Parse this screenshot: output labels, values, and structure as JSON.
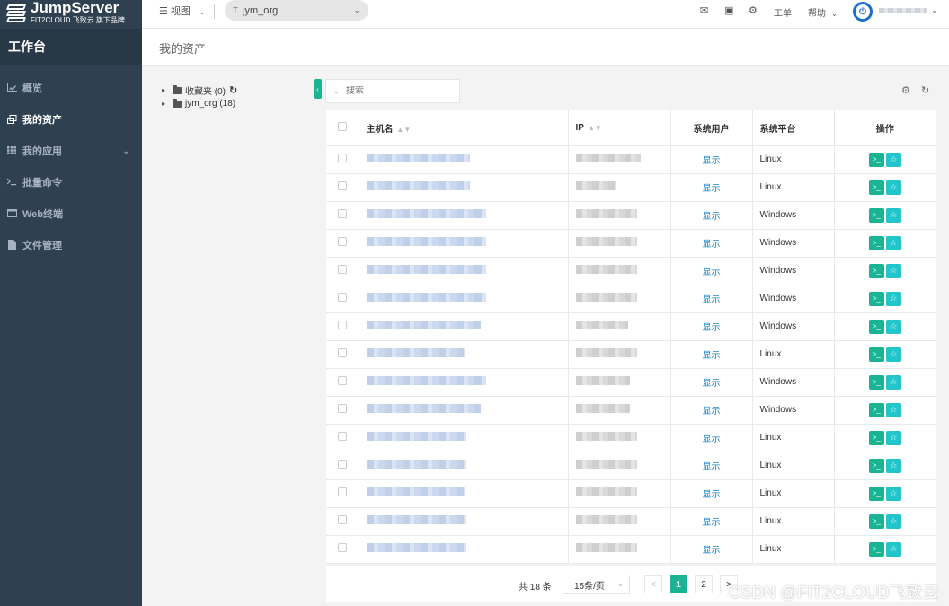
{
  "app": {
    "logo_title": "JumpServer",
    "logo_subtitle": "FIT2CLOUD 飞致云 旗下品牌",
    "workspace": "工作台"
  },
  "sidebar": {
    "items": [
      {
        "label": "概览",
        "icon": "chart-icon",
        "active": false
      },
      {
        "label": "我的资产",
        "icon": "assets-icon",
        "active": true
      },
      {
        "label": "我的应用",
        "icon": "apps-grid-icon",
        "active": false,
        "has_caret": true
      },
      {
        "label": "批量命令",
        "icon": "terminal-prompt-icon",
        "active": false
      },
      {
        "label": "Web终端",
        "icon": "window-icon",
        "active": false
      },
      {
        "label": "文件管理",
        "icon": "file-icon",
        "active": false
      }
    ]
  },
  "topnav": {
    "view_label": "视图",
    "org": "jym_org",
    "ticket_label": "工单",
    "help_label": "帮助"
  },
  "page": {
    "title": "我的资产"
  },
  "tree": {
    "nodes": [
      {
        "label": "收藏夹 (0)"
      },
      {
        "label": "jym_org (18)"
      }
    ]
  },
  "search": {
    "placeholder": "搜索"
  },
  "table": {
    "headers": {
      "hostname": "主机名",
      "ip": "IP",
      "system_user": "系统用户",
      "platform": "系统平台",
      "actions": "操作"
    },
    "show_label": "显示",
    "rows": [
      {
        "platform": "Linux",
        "host_w": 115,
        "ip_w": 72
      },
      {
        "platform": "Linux",
        "host_w": 115,
        "ip_w": 44
      },
      {
        "platform": "Windows",
        "host_w": 133,
        "ip_w": 68
      },
      {
        "platform": "Windows",
        "host_w": 133,
        "ip_w": 68
      },
      {
        "platform": "Windows",
        "host_w": 133,
        "ip_w": 68
      },
      {
        "platform": "Windows",
        "host_w": 133,
        "ip_w": 68
      },
      {
        "platform": "Windows",
        "host_w": 127,
        "ip_w": 58
      },
      {
        "platform": "Linux",
        "host_w": 109,
        "ip_w": 68
      },
      {
        "platform": "Windows",
        "host_w": 133,
        "ip_w": 60
      },
      {
        "platform": "Windows",
        "host_w": 127,
        "ip_w": 60
      },
      {
        "platform": "Linux",
        "host_w": 111,
        "ip_w": 68
      },
      {
        "platform": "Linux",
        "host_w": 111,
        "ip_w": 68
      },
      {
        "platform": "Linux",
        "host_w": 109,
        "ip_w": 68
      },
      {
        "platform": "Linux",
        "host_w": 111,
        "ip_w": 68
      },
      {
        "platform": "Linux",
        "host_w": 111,
        "ip_w": 68
      }
    ]
  },
  "pagination": {
    "total": "共 18 条",
    "page_size": "15条/页",
    "pages": [
      "1",
      "2"
    ],
    "current": "1",
    "prev": "<",
    "next": ">"
  },
  "watermark": "CSDN @FIT2CLOUD飞致云",
  "colors": {
    "sidebar": "#2f4050",
    "primary": "#1ab394",
    "info": "#23c6c8",
    "link": "#1c84c6"
  }
}
